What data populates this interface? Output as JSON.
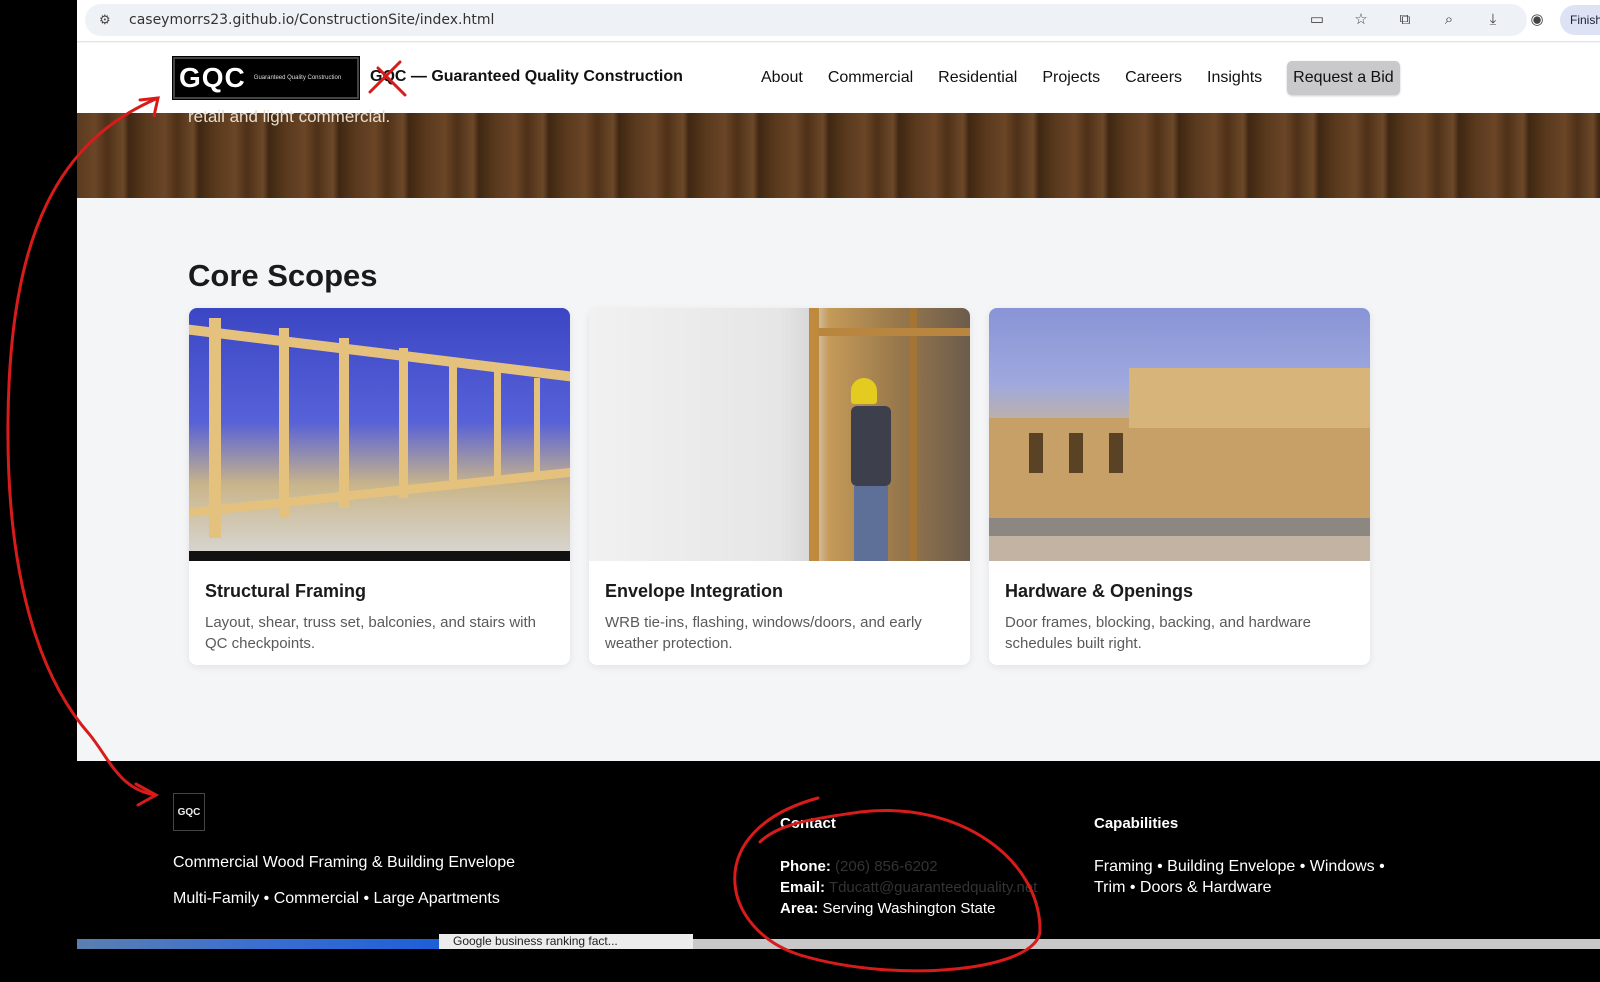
{
  "browser": {
    "url": "caseymorrs23.github.io/ConstructionSite/index.html",
    "profile_label": "Finish"
  },
  "header": {
    "logo_text": "GQC",
    "logo_tagline": "Guaranteed Quality Construction",
    "brand_name": "GQC — Guaranteed Quality Construction",
    "nav": [
      "About",
      "Commercial",
      "Residential",
      "Projects",
      "Careers",
      "Insights"
    ],
    "cta": "Request a Bid"
  },
  "hero": {
    "text": "retail and light commercial."
  },
  "core_scopes": {
    "title": "Core Scopes",
    "cards": [
      {
        "title": "Structural Framing",
        "desc": "Layout, shear, truss set, balconies, and stairs with QC checkpoints."
      },
      {
        "title": "Envelope Integration",
        "desc": "WRB tie-ins, flashing, windows/doors, and early weather protection."
      },
      {
        "title": "Hardware & Openings",
        "desc": "Door frames, blocking, backing, and hardware schedules built right."
      }
    ]
  },
  "footer": {
    "logo_text": "GQC",
    "line1": "Commercial Wood Framing & Building Envelope",
    "line2": "Multi-Family • Commercial • Large Apartments",
    "contact_heading": "Contact",
    "phone_label": "Phone:",
    "phone_value": "(206) 856-6202",
    "email_label": "Email:",
    "email_value": "Tducatt@guaranteedquality.net",
    "area_label": "Area:",
    "area_value": "Serving Washington State",
    "capabilities_heading": "Capabilities",
    "capabilities_text": "Framing • Building Envelope • Windows • Trim • Doors & Hardware"
  },
  "taskbar": {
    "item": "Google business ranking fact..."
  },
  "colors": {
    "annotation": "#d81b1b",
    "footer_bg": "#000000",
    "page_bg": "#f4f5f7"
  }
}
